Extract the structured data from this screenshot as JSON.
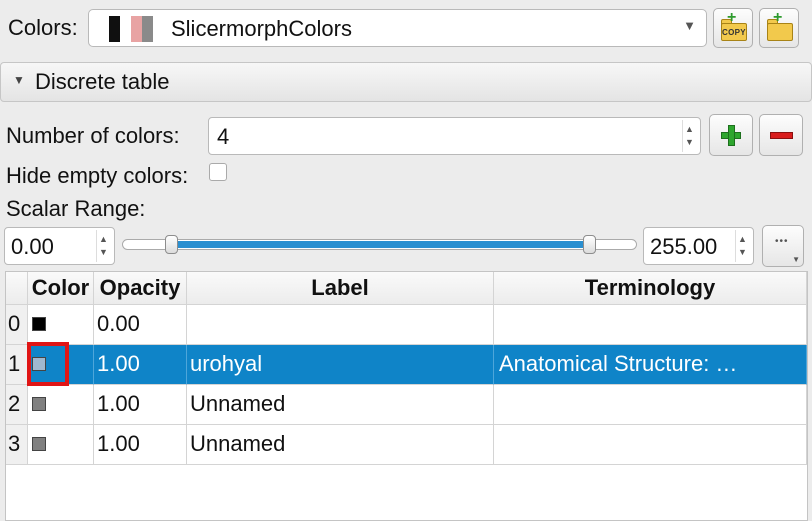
{
  "colors_row": {
    "label": "Colors:",
    "selected_table": "SlicermorphColors",
    "swatch_strip": [
      "#101010",
      "#ffffff",
      "#e8a3a3",
      "#8a8a8a"
    ],
    "copy_icon": "copy-folder-icon",
    "load_icon": "add-folder-icon",
    "copy_text": "COPY"
  },
  "discrete_section": {
    "title": "Discrete table"
  },
  "number_of_colors": {
    "label": "Number of colors:",
    "value": "4"
  },
  "hide_empty": {
    "label": "Hide empty colors:",
    "checked": false
  },
  "scalar_range": {
    "label": "Scalar Range:",
    "min": "0.00",
    "max": "255.00",
    "slider_min_fraction": 0.0,
    "slider_max_fraction": 1.0
  },
  "table": {
    "headers": {
      "color": "Color",
      "opacity": "Opacity",
      "label": "Label",
      "terminology": "Terminology"
    },
    "rows": [
      {
        "index": "0",
        "color": "#000000",
        "opacity": "0.00",
        "label": "",
        "terminology": "",
        "selected": false
      },
      {
        "index": "1",
        "color": "#9fb8cf",
        "opacity": "1.00",
        "label": "urohyal",
        "terminology": "Anatomical Structure: …",
        "selected": true
      },
      {
        "index": "2",
        "color": "#808080",
        "opacity": "1.00",
        "label": "Unnamed",
        "terminology": "",
        "selected": false
      },
      {
        "index": "3",
        "color": "#808080",
        "opacity": "1.00",
        "label": "Unnamed",
        "terminology": "",
        "selected": false
      }
    ]
  },
  "accent_colors": {
    "selection": "#0f84c8",
    "highlight_box": "#e01515",
    "slider_fill": "#2a8fd0"
  }
}
